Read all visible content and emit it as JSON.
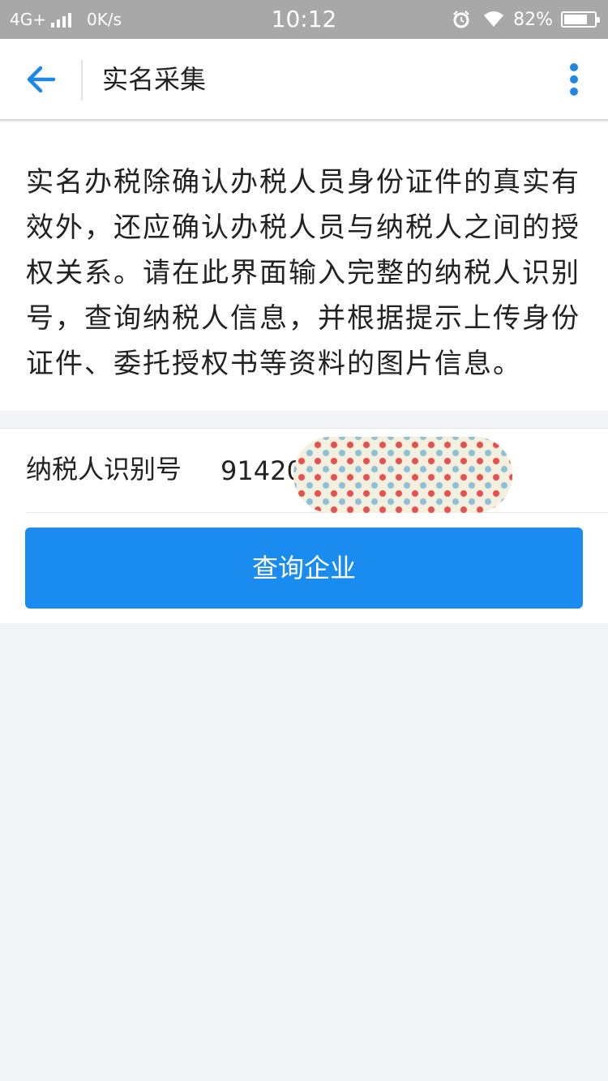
{
  "status_bar": {
    "network": "4G+",
    "speed": "0K/s",
    "time": "10:12",
    "battery": "82%",
    "icons": [
      "signal-icon",
      "alarm-icon",
      "wifi-icon",
      "battery-icon"
    ]
  },
  "nav": {
    "back_icon": "arrow-left-icon",
    "title": "实名采集",
    "more_icon": "more-vertical-icon"
  },
  "intro": {
    "text": "实名办税除确认办税人员身份证件的真实有效外，还应确认办税人员与纳税人之间的授权关系。请在此界面输入完整的纳税人识别号，查询纳税人信息，并根据提示上传身份证件、委托授权书等资料的图片信息。"
  },
  "form": {
    "tax_id_label": "纳税人识别号",
    "tax_id_value": "91420                    7D",
    "query_button_label": "查询企业"
  },
  "colors": {
    "accent": "#1a8cf0",
    "background": "#f2f4f7",
    "status_bar": "#a8a8a8"
  }
}
